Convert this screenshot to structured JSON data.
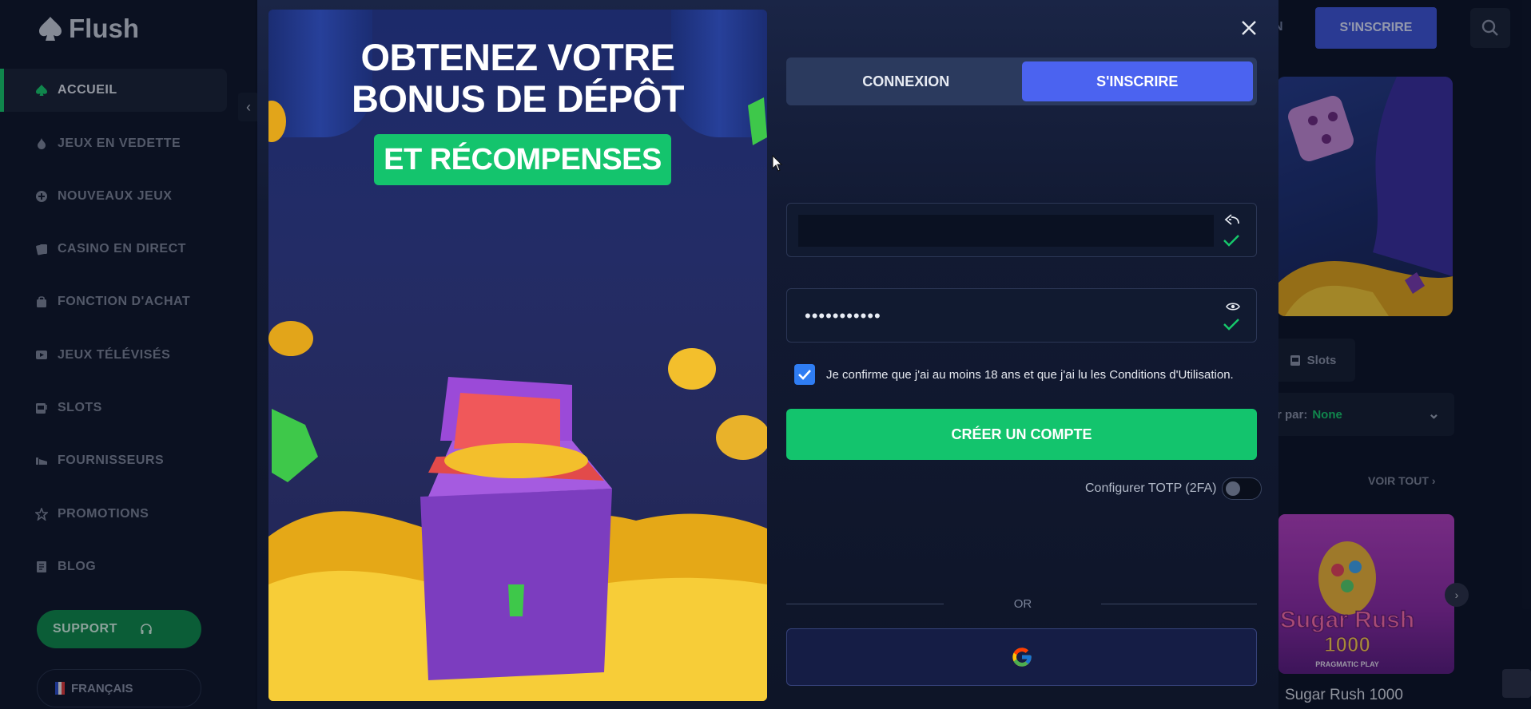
{
  "sidebar": {
    "logo": "Flush",
    "items": [
      {
        "label": "ACCUEIL",
        "icon": "spade-icon"
      },
      {
        "label": "JEUX EN VEDETTE",
        "icon": "fire-icon"
      },
      {
        "label": "NOUVEAUX JEUX",
        "icon": "plus-circle-icon"
      },
      {
        "label": "CASINO EN DIRECT",
        "icon": "cards-icon"
      },
      {
        "label": "FONCTION D'ACHAT",
        "icon": "bag-icon"
      },
      {
        "label": "JEUX TÉLÉVISÉS",
        "icon": "tv-icon"
      },
      {
        "label": "SLOTS",
        "icon": "slot-machine-icon"
      },
      {
        "label": "FOURNISSEURS",
        "icon": "providers-icon"
      },
      {
        "label": "PROMOTIONS",
        "icon": "star-icon"
      },
      {
        "label": "BLOG",
        "icon": "document-icon"
      }
    ],
    "support_label": "SUPPORT",
    "language_label": "FRANÇAIS"
  },
  "header": {
    "login_fragment": "N",
    "signup_label": "S'INSCRIRE"
  },
  "background": {
    "slots_label": "Slots",
    "sort_label": "r par:",
    "sort_value": "None",
    "voir_tout": "VOIR TOUT",
    "game_title": "Sugar Rush 1000",
    "game_art_title": "Sugar Rush",
    "game_art_number": "1000",
    "game_provider": "PRAGMATIC PLAY"
  },
  "modal": {
    "promo": {
      "title_line1": "OBTENEZ VOTRE",
      "title_line2": "BONUS DE DÉPÔT",
      "badge": "ET RÉCOMPENSES"
    },
    "tabs": [
      {
        "label": "CONNEXION",
        "active": false
      },
      {
        "label": "S'INSCRIRE",
        "active": true
      }
    ],
    "email_value": "",
    "password_value": "•••••••••••",
    "consent_text": "Je confirme que j'ai au moins 18 ans et que j'ai lu les Conditions d'Utilisation.",
    "consent_checked": true,
    "create_label": "CRÉER UN COMPTE",
    "totp_label": "Configurer TOTP (2FA)",
    "totp_enabled": false,
    "or_label": "OR",
    "google_icon": "google-icon"
  },
  "colors": {
    "accent_green": "#13c46d",
    "accent_blue": "#4b63f0",
    "sidebar_bg": "#0e1629",
    "modal_bg": "#121a33"
  }
}
